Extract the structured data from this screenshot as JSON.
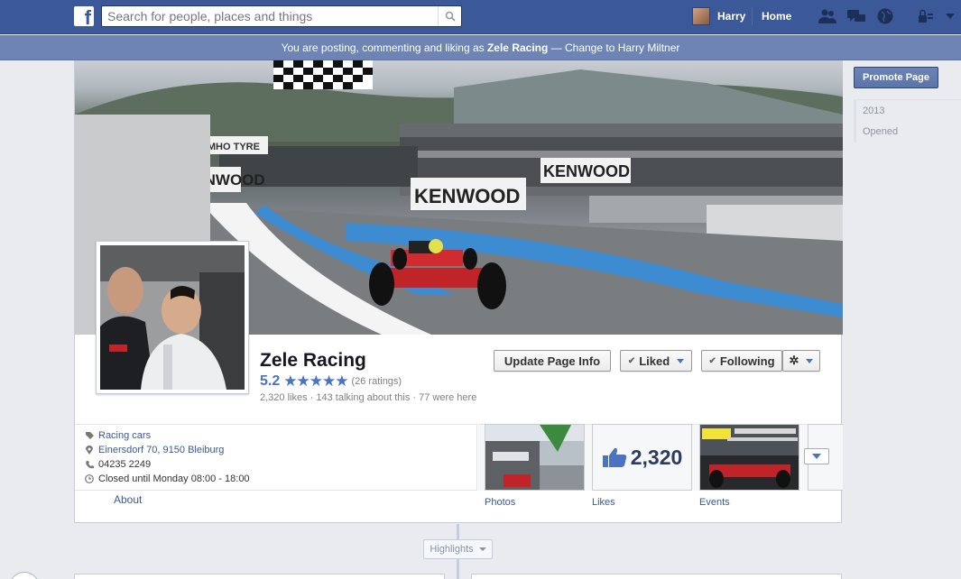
{
  "topbar": {
    "logo_letter": "f",
    "search_placeholder": "Search for people, places and things",
    "user_name": "Harry",
    "home_label": "Home"
  },
  "posting_bar": {
    "prefix": "You are posting, commenting and liking as ",
    "page_name": "Zele Racing",
    "suffix": " — Change to Harry Miltner"
  },
  "cover": {
    "banners": [
      "KUMHO TYRE",
      "KENWOOD",
      "KENWOOD",
      "KENWOOD"
    ]
  },
  "page": {
    "name": "Zele Racing",
    "rating_value": "5.2",
    "stars": "★★★★★",
    "rating_count": "(26 ratings)",
    "stats": "2,320 likes · 143 talking about this · 77 were here"
  },
  "actions": {
    "update_info": "Update Page Info",
    "liked": "Liked",
    "following": "Following"
  },
  "about": {
    "category": "Racing cars",
    "address": "Einersdorf 70, 9150 Bleiburg",
    "phone": "04235 2249",
    "hours": "Closed until Monday 08:00 - 18:00",
    "tab_label": "About"
  },
  "tiles": {
    "photos_label": "Photos",
    "likes_label": "Likes",
    "likes_count": "2,320",
    "events_label": "Events"
  },
  "sidebar": {
    "promote_label": "Promote Page",
    "scrubber": [
      "2013",
      "Opened"
    ]
  },
  "timeline": {
    "highlights_label": "Highlights"
  },
  "colors": {
    "brand": "#3b5998",
    "accent": "#4b73c0"
  }
}
